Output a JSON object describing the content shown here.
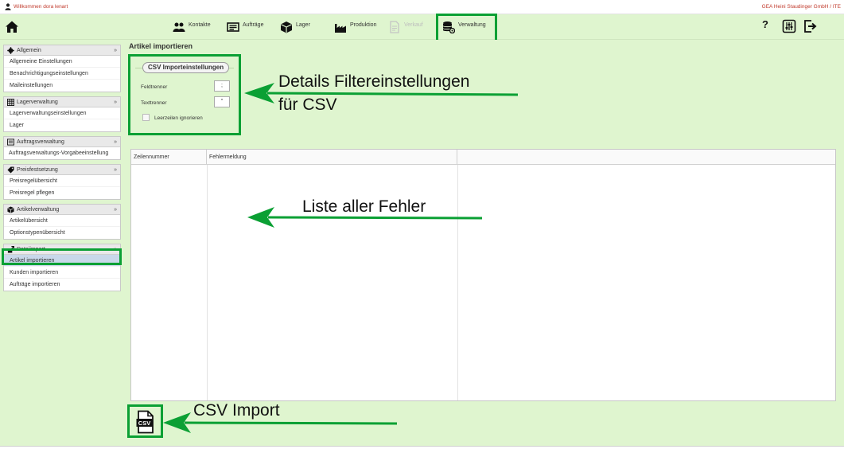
{
  "header": {
    "welcome": "Willkommen dora lenart",
    "company": "GEA Heini Staudinger GmbH / ITE"
  },
  "nav": {
    "items": [
      {
        "label": "Kontakte"
      },
      {
        "label": "Aufträge"
      },
      {
        "label": "Lager"
      },
      {
        "label": "Produktion"
      },
      {
        "label": "Verkauf",
        "disabled": true
      },
      {
        "label": "Verwaltung"
      }
    ],
    "help": "?"
  },
  "sidebar": {
    "groups": [
      {
        "title": "Allgemein",
        "items": [
          "Allgemeine Einstellungen",
          "Benachrichtigungseinstellungen",
          "Maileinstellungen"
        ]
      },
      {
        "title": "Lagerverwaltung",
        "items": [
          "Lagerverwaltungseinstellungen",
          "Lager"
        ]
      },
      {
        "title": "Auftragsverwaltung",
        "items": [
          "Auftragsverwaltungs-Vorgabeeinstellung"
        ]
      },
      {
        "title": "Preisfestsetzung",
        "items": [
          "Preisregelübersicht",
          "Preisregel pflegen"
        ]
      },
      {
        "title": "Artikelverwaltung",
        "items": [
          "Artikelübersicht",
          "Optionstypenübersicht"
        ]
      },
      {
        "title": "Dateiimport",
        "items": [
          "Artikel importieren",
          "Kunden importieren",
          "Aufträge importieren"
        ]
      }
    ],
    "chevron": "»"
  },
  "page": {
    "title": "Artikel importieren"
  },
  "csv_settings": {
    "title": "CSV Importeinstellungen",
    "field_separator_label": "Feldtrenner",
    "field_separator_value": ";",
    "text_separator_label": "Texttrenner",
    "text_separator_value": "\"",
    "ignore_empty_label": "Leerzeilen ignorieren",
    "ignore_empty_checked": false
  },
  "error_table": {
    "columns": [
      "Zeilennummer",
      "Fehlermeldung",
      ""
    ],
    "rows": []
  },
  "annotations": {
    "details_line1": "Details Filtereinstellungen",
    "details_line2": "für CSV",
    "errors": "Liste aller Fehler",
    "csv_import": "CSV Import"
  },
  "colors": {
    "highlight": "#0ba034",
    "background": "#dff5cf",
    "welcome_text": "#c0392b"
  }
}
